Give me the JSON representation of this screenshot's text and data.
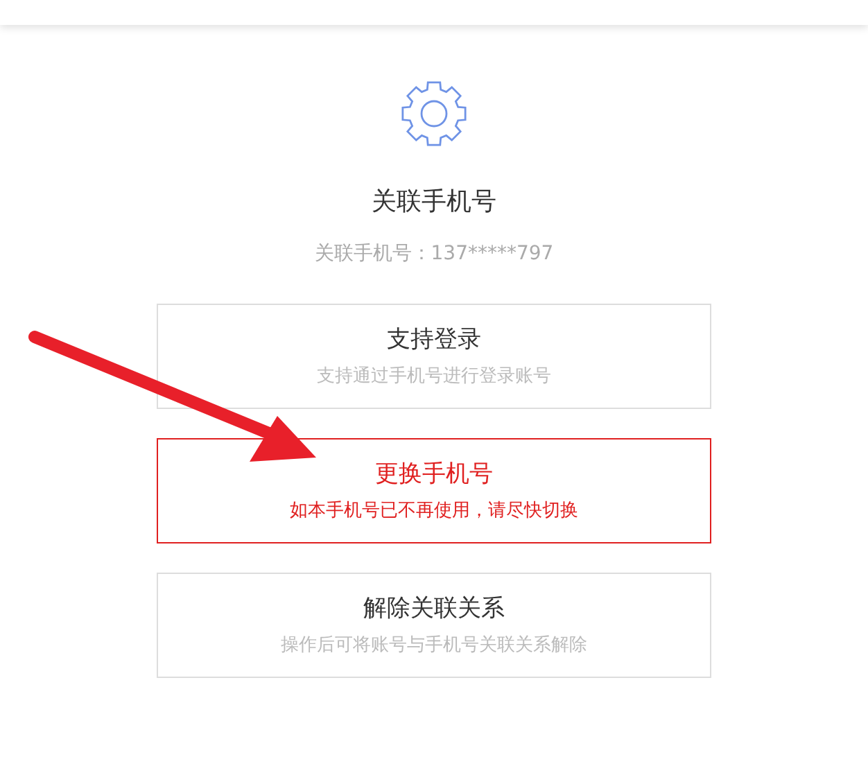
{
  "header": {
    "title": "关联手机号",
    "phone_label": "关联手机号：137*****797"
  },
  "options": [
    {
      "title": "支持登录",
      "description": "支持通过手机号进行登录账号",
      "highlighted": false
    },
    {
      "title": "更换手机号",
      "description": "如本手机号已不再使用，请尽快切换",
      "highlighted": true
    },
    {
      "title": "解除关联关系",
      "description": "操作后可将账号与手机号关联关系解除",
      "highlighted": false
    }
  ]
}
